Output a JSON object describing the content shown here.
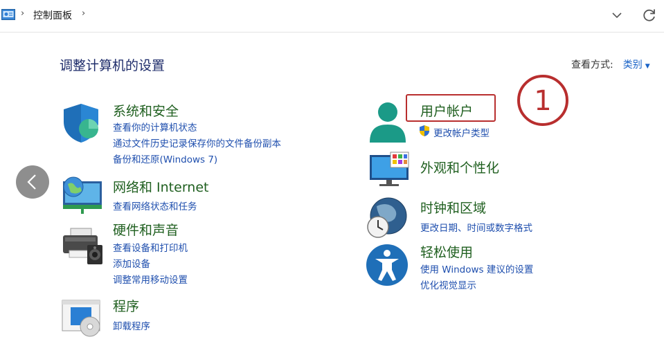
{
  "breadcrumb": {
    "label": "控制面板"
  },
  "page": {
    "title": "调整计算机的设置"
  },
  "view": {
    "label": "查看方式:",
    "value": "类别"
  },
  "left_column": [
    {
      "title": "系统和安全",
      "links": [
        "查看你的计算机状态",
        "通过文件历史记录保存你的文件备份副本",
        "备份和还原(Windows 7)"
      ]
    },
    {
      "title": "网络和 Internet",
      "links": [
        "查看网络状态和任务"
      ]
    },
    {
      "title": "硬件和声音",
      "links": [
        "查看设备和打印机",
        "添加设备",
        "调整常用移动设置"
      ]
    },
    {
      "title": "程序",
      "links": [
        "卸载程序"
      ]
    }
  ],
  "right_column": [
    {
      "title": "用户帐户",
      "links": [
        "更改帐户类型"
      ]
    },
    {
      "title": "外观和个性化",
      "links": []
    },
    {
      "title": "时钟和区域",
      "links": [
        "更改日期、时间或数字格式"
      ]
    },
    {
      "title": "轻松使用",
      "links": [
        "使用 Windows 建议的设置",
        "优化视觉显示"
      ]
    }
  ],
  "annotation": {
    "marker": "①",
    "color": "#b82e2e"
  },
  "colors": {
    "title_green": "#1f5f1f",
    "link_blue": "#1f4fae",
    "heading_navy": "#1f2d6b"
  }
}
